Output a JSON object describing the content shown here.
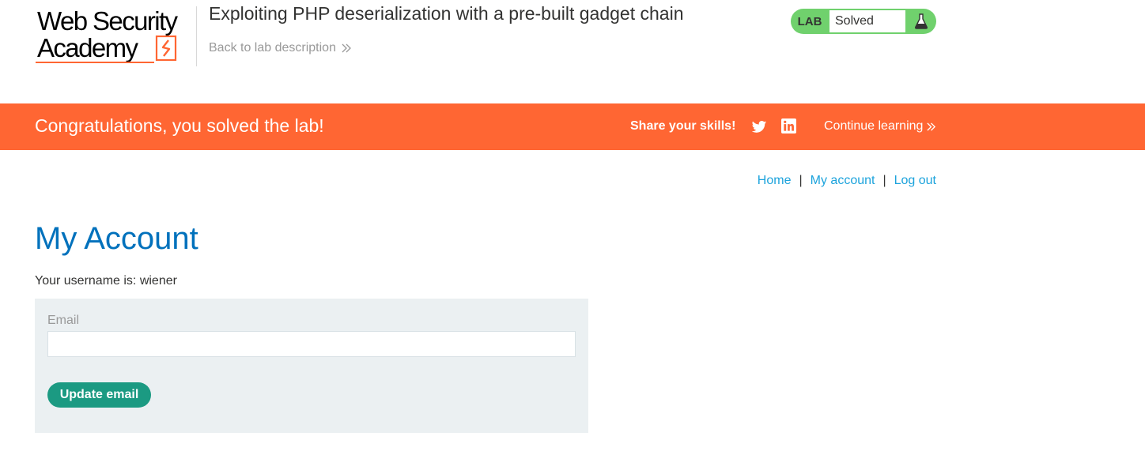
{
  "header": {
    "logo_line1": "Web Security",
    "logo_line2": "Academy",
    "lab_title": "Exploiting PHP deserialization with a pre-built gadget chain",
    "back_link": "Back to lab description",
    "lab_status": {
      "tag": "LAB",
      "value": "Solved",
      "icon": "flask-icon"
    }
  },
  "banner": {
    "message": "Congratulations, you solved the lab!",
    "share_label": "Share your skills!",
    "twitter_icon": "twitter-icon",
    "linkedin_icon": "linkedin-icon",
    "continue_link": "Continue learning"
  },
  "nav": {
    "items": [
      "Home",
      "My account",
      "Log out"
    ],
    "separator": "|"
  },
  "main": {
    "title": "My Account",
    "username_line": "Your username is: wiener",
    "form": {
      "email_label": "Email",
      "email_value": "",
      "submit_label": "Update email"
    }
  },
  "colors": {
    "brand_orange": "#ff6633",
    "lab_solved_green": "#70d16d",
    "title_blue": "#0071bc",
    "link_blue": "#1ca3dc",
    "button_teal": "#1b9a82",
    "panel_bg": "#ebf0f2"
  }
}
